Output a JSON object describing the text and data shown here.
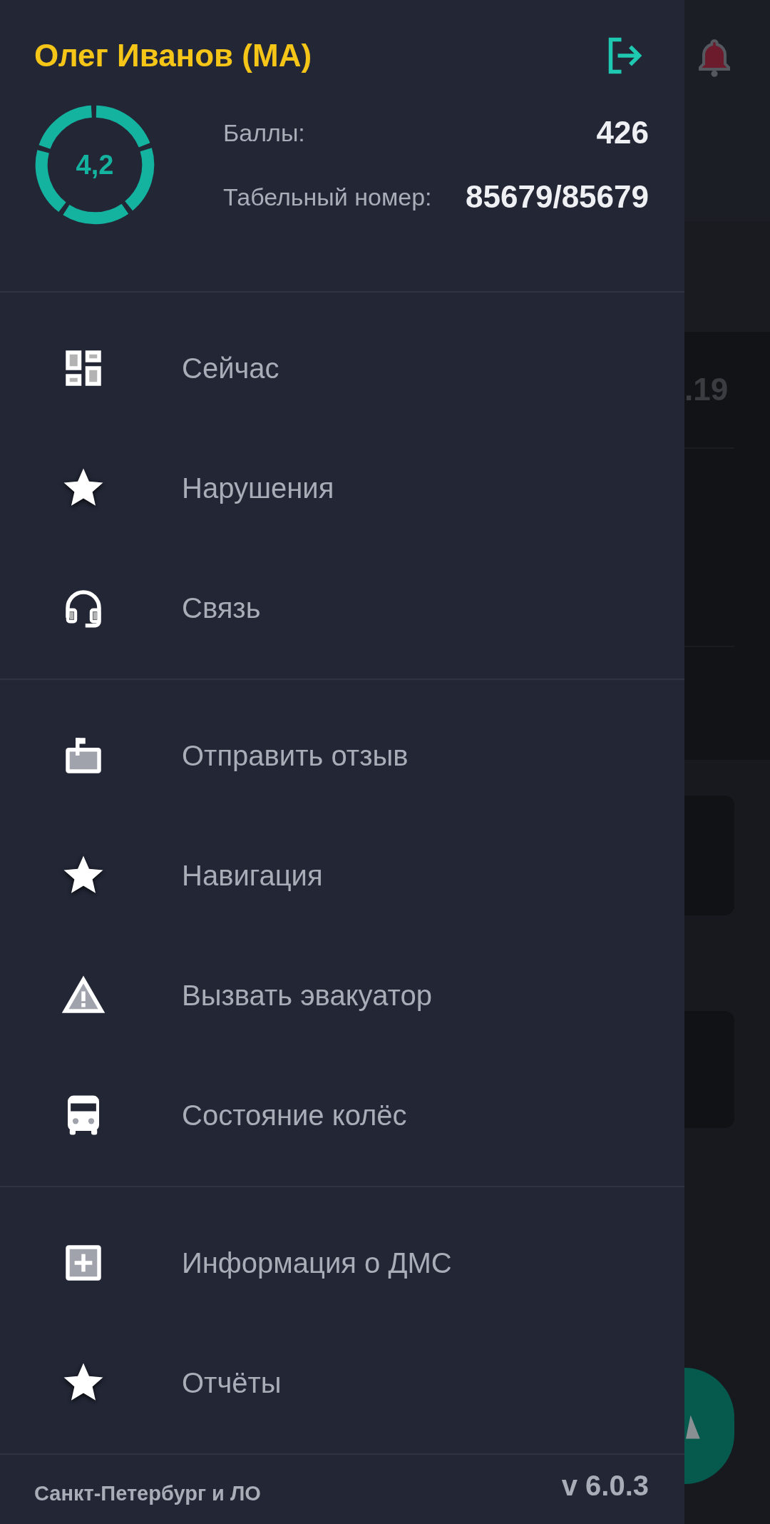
{
  "background_screen": {
    "date_fragment": ".19"
  },
  "header": {
    "user_name": "Олег Иванов (МА)",
    "rating": "4,2",
    "stats": [
      {
        "label": "Баллы:",
        "value": "426"
      },
      {
        "label": "Табельный номер:",
        "value": "85679/85679"
      }
    ]
  },
  "menu_groups": [
    {
      "items": [
        {
          "label": "Сейчас",
          "kind": "dashboard"
        },
        {
          "label": "Нарушения",
          "kind": "star"
        },
        {
          "label": "Связь",
          "kind": "headset"
        }
      ]
    },
    {
      "items": [
        {
          "label": "Отправить отзыв",
          "kind": "mailbox"
        },
        {
          "label": "Навигация",
          "kind": "star"
        },
        {
          "label": "Вызвать эвакуатор",
          "kind": "warning"
        },
        {
          "label": "Состояние колёс",
          "kind": "bus"
        }
      ]
    },
    {
      "items": [
        {
          "label": "Информация о ДМС",
          "kind": "medical"
        },
        {
          "label": "Отчёты",
          "kind": "star"
        }
      ]
    }
  ],
  "footer": {
    "region": "Санкт-Петербург и ЛО",
    "version": "v 6.0.3"
  }
}
